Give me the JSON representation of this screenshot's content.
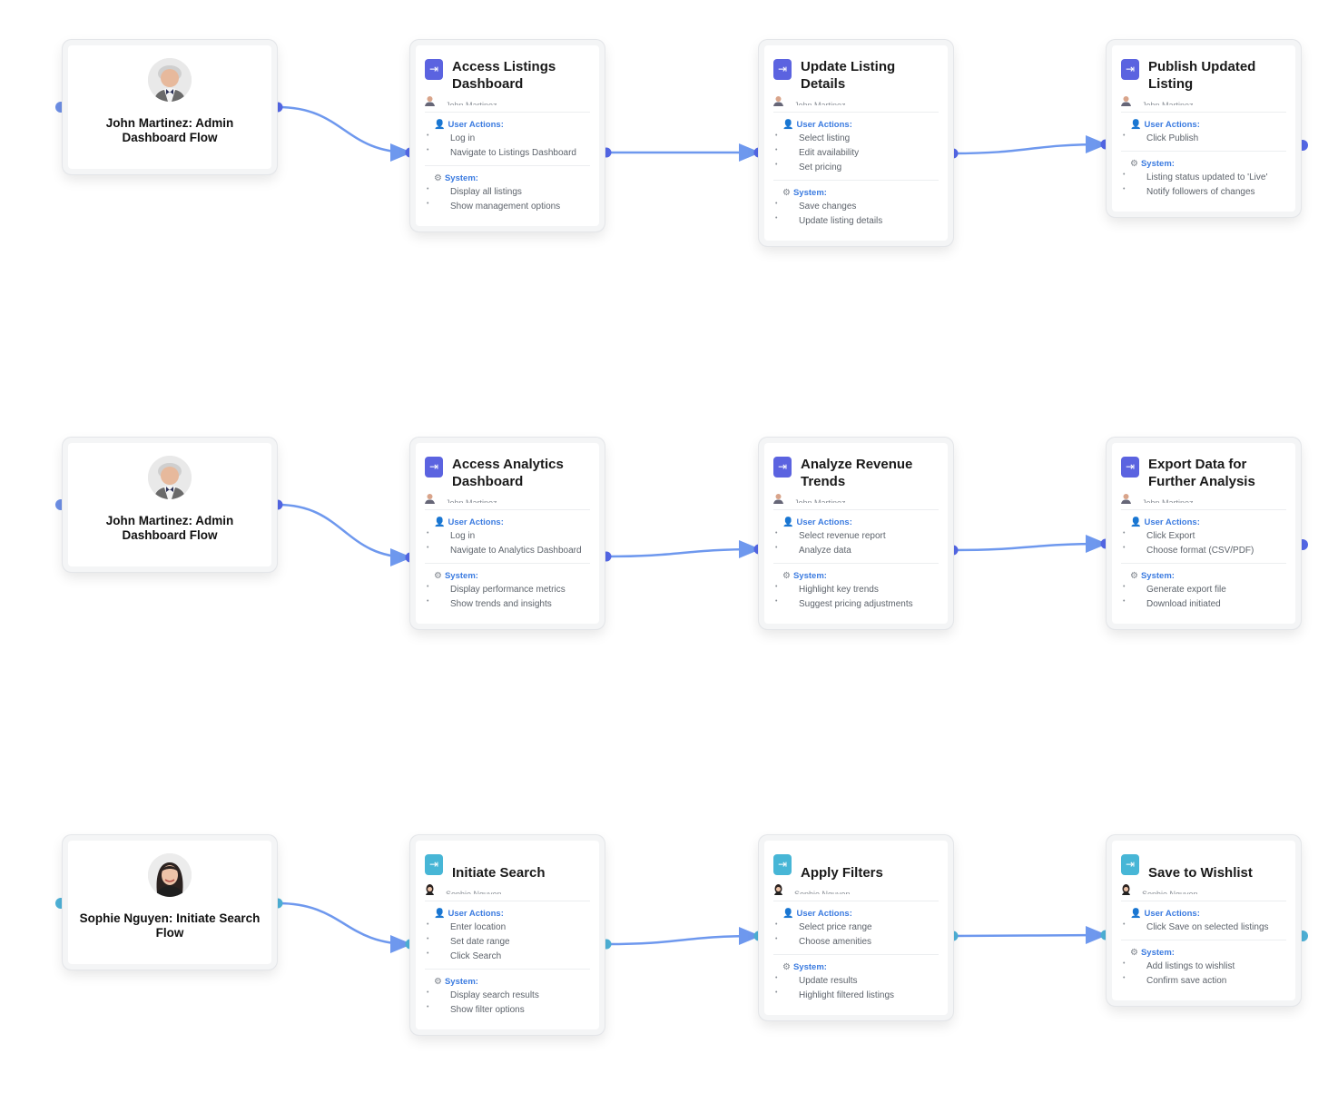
{
  "colors": {
    "edge": "#6e98ee",
    "admin_handle": "#5468e8",
    "admin_icon": "#5b63e0",
    "search_handle": "#4eb2d8",
    "search_icon": "#47b6d6",
    "label_blue": "#3b7be0"
  },
  "flows": [
    {
      "actor": {
        "name": "John Martinez: Admin Dashboard Flow",
        "avatar": "avatar-man"
      },
      "steps": [
        {
          "title": "Access Listings Dashboard",
          "owner": "John Martinez",
          "user_actions_label": "User Actions:",
          "user_actions": [
            "Log in",
            "Navigate to Listings Dashboard"
          ],
          "system_label": "System:",
          "system": [
            "Display all listings",
            "Show management options"
          ]
        },
        {
          "title": "Update Listing Details",
          "owner": "John Martinez",
          "user_actions_label": "User Actions:",
          "user_actions": [
            "Select listing",
            "Edit availability",
            "Set pricing"
          ],
          "system_label": "System:",
          "system": [
            "Save changes",
            "Update listing details"
          ]
        },
        {
          "title": "Publish Updated Listing",
          "owner": "John Martinez",
          "user_actions_label": "User Actions:",
          "user_actions": [
            "Click Publish"
          ],
          "system_label": "System:",
          "system": [
            "Listing status updated to 'Live'",
            "Notify followers of changes"
          ]
        }
      ]
    },
    {
      "actor": {
        "name": "John Martinez: Admin Dashboard Flow",
        "avatar": "avatar-man"
      },
      "steps": [
        {
          "title": "Access Analytics Dashboard",
          "owner": "John Martinez",
          "user_actions_label": "User Actions:",
          "user_actions": [
            "Log in",
            "Navigate to Analytics Dashboard"
          ],
          "system_label": "System:",
          "system": [
            "Display performance metrics",
            "Show trends and insights"
          ]
        },
        {
          "title": "Analyze Revenue Trends",
          "owner": "John Martinez",
          "user_actions_label": "User Actions:",
          "user_actions": [
            "Select revenue report",
            "Analyze data"
          ],
          "system_label": "System:",
          "system": [
            "Highlight key trends",
            "Suggest pricing adjustments"
          ]
        },
        {
          "title": "Export Data for Further Analysis",
          "owner": "John Martinez",
          "user_actions_label": "User Actions:",
          "user_actions": [
            "Click Export",
            "Choose format (CSV/PDF)"
          ],
          "system_label": "System:",
          "system": [
            "Generate export file",
            "Download initiated"
          ]
        }
      ]
    },
    {
      "actor": {
        "name": "Sophie Nguyen: Initiate Search Flow",
        "avatar": "avatar-woman"
      },
      "steps": [
        {
          "title": "Initiate Search",
          "owner": "Sophie Nguyen",
          "user_actions_label": "User Actions:",
          "user_actions": [
            "Enter location",
            "Set date range",
            "Click Search"
          ],
          "system_label": "System:",
          "system": [
            "Display search results",
            "Show filter options"
          ]
        },
        {
          "title": "Apply Filters",
          "owner": "Sophie Nguyen",
          "user_actions_label": "User Actions:",
          "user_actions": [
            "Select price range",
            "Choose amenities"
          ],
          "system_label": "System:",
          "system": [
            "Update results",
            "Highlight filtered listings"
          ]
        },
        {
          "title": "Save to Wishlist",
          "owner": "Sophie Nguyen",
          "user_actions_label": "User Actions:",
          "user_actions": [
            "Click Save on selected listings"
          ],
          "system_label": "System:",
          "system": [
            "Add listings to wishlist",
            "Confirm save action"
          ]
        }
      ]
    }
  ]
}
